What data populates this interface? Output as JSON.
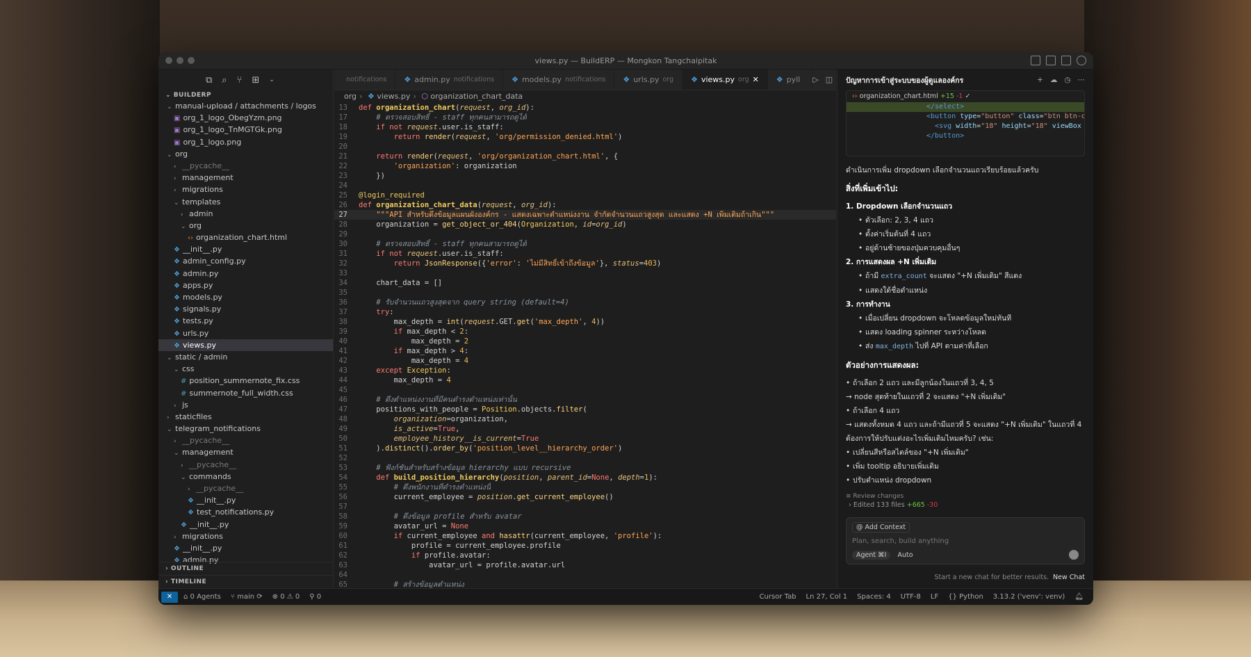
{
  "window": {
    "title": "views.py — BuildERP — Mongkon Tangchaipitak"
  },
  "explorer": {
    "section": "BUILDERP",
    "outline": "OUTLINE",
    "timeline": "TIMELINE",
    "items": [
      {
        "label": "manual-upload / attachments / logos",
        "indent": 0,
        "type": "folder-open"
      },
      {
        "label": "org_1_logo_ObegYzm.png",
        "indent": 1,
        "type": "img"
      },
      {
        "label": "org_1_logo_TnMGTGk.png",
        "indent": 1,
        "type": "img"
      },
      {
        "label": "org_1_logo.png",
        "indent": 1,
        "type": "img"
      },
      {
        "label": "org",
        "indent": 0,
        "type": "folder-open"
      },
      {
        "label": "__pycache__",
        "indent": 1,
        "type": "folder",
        "dim": true
      },
      {
        "label": "management",
        "indent": 1,
        "type": "folder"
      },
      {
        "label": "migrations",
        "indent": 1,
        "type": "folder"
      },
      {
        "label": "templates",
        "indent": 1,
        "type": "folder-open"
      },
      {
        "label": "admin",
        "indent": 2,
        "type": "folder"
      },
      {
        "label": "org",
        "indent": 2,
        "type": "folder-open"
      },
      {
        "label": "organization_chart.html",
        "indent": 3,
        "type": "html"
      },
      {
        "label": "__init__.py",
        "indent": 1,
        "type": "py"
      },
      {
        "label": "admin_config.py",
        "indent": 1,
        "type": "py"
      },
      {
        "label": "admin.py",
        "indent": 1,
        "type": "py"
      },
      {
        "label": "apps.py",
        "indent": 1,
        "type": "py"
      },
      {
        "label": "models.py",
        "indent": 1,
        "type": "py"
      },
      {
        "label": "signals.py",
        "indent": 1,
        "type": "py"
      },
      {
        "label": "tests.py",
        "indent": 1,
        "type": "py"
      },
      {
        "label": "urls.py",
        "indent": 1,
        "type": "py"
      },
      {
        "label": "views.py",
        "indent": 1,
        "type": "py",
        "selected": true
      },
      {
        "label": "static / admin",
        "indent": 0,
        "type": "folder-open"
      },
      {
        "label": "css",
        "indent": 1,
        "type": "folder-open"
      },
      {
        "label": "position_summernote_fix.css",
        "indent": 2,
        "type": "css"
      },
      {
        "label": "summernote_full_width.css",
        "indent": 2,
        "type": "css"
      },
      {
        "label": "js",
        "indent": 1,
        "type": "folder"
      },
      {
        "label": "staticfiles",
        "indent": 0,
        "type": "folder"
      },
      {
        "label": "telegram_notifications",
        "indent": 0,
        "type": "folder-open"
      },
      {
        "label": "__pycache__",
        "indent": 1,
        "type": "folder",
        "dim": true
      },
      {
        "label": "management",
        "indent": 1,
        "type": "folder-open"
      },
      {
        "label": "__pycache__",
        "indent": 2,
        "type": "folder",
        "dim": true
      },
      {
        "label": "commands",
        "indent": 2,
        "type": "folder-open"
      },
      {
        "label": "__pycache__",
        "indent": 3,
        "type": "folder",
        "dim": true
      },
      {
        "label": "__init__.py",
        "indent": 3,
        "type": "py"
      },
      {
        "label": "test_notifications.py",
        "indent": 3,
        "type": "py"
      },
      {
        "label": "__init__.py",
        "indent": 2,
        "type": "py"
      },
      {
        "label": "migrations",
        "indent": 1,
        "type": "folder"
      },
      {
        "label": "__init__.py",
        "indent": 1,
        "type": "py"
      },
      {
        "label": "admin.py",
        "indent": 1,
        "type": "py"
      }
    ]
  },
  "tabs": [
    {
      "label": "",
      "sub": "notifications",
      "active": false
    },
    {
      "label": "admin.py",
      "sub": "notifications",
      "active": false
    },
    {
      "label": "models.py",
      "sub": "notifications",
      "active": false
    },
    {
      "label": "urls.py",
      "sub": "org",
      "active": false
    },
    {
      "label": "views.py",
      "sub": "org",
      "active": true
    },
    {
      "label": "pyll",
      "sub": "",
      "active": false
    }
  ],
  "breadcrumb": {
    "a": "org",
    "b": "views.py",
    "c": "organization_chart_data"
  },
  "code": [
    {
      "n": 13,
      "h": "<span class='kw'>def</span> <span class='fn'>organization_chart</span>(<span class='pr'>request</span>, <span class='pr'>org_id</span>):"
    },
    {
      "n": 17,
      "h": "    <span class='cm'># ตรวจสอบสิทธิ์ - staff ทุกคนสามารถดูได้</span>"
    },
    {
      "n": 18,
      "h": "    <span class='kw'>if not</span> <span class='pr'>request</span>.user.is_staff:"
    },
    {
      "n": 19,
      "h": "        <span class='kw'>return</span> <span class='bi'>render</span>(<span class='pr'>request</span>, <span class='st'>'org/permission_denied.html'</span>)"
    },
    {
      "n": 20,
      "h": ""
    },
    {
      "n": 21,
      "h": "    <span class='kw'>return</span> <span class='bi'>render</span>(<span class='pr'>request</span>, <span class='st'>'org/organization_chart.html'</span>, {"
    },
    {
      "n": 22,
      "h": "        <span class='st'>'organization'</span>: organization"
    },
    {
      "n": 23,
      "h": "    })"
    },
    {
      "n": 24,
      "h": ""
    },
    {
      "n": 25,
      "h": "<span class='dec'>@login_required</span>"
    },
    {
      "n": 26,
      "h": "<span class='kw'>def</span> <span class='fn'>organization_chart_data</span>(<span class='pr'>request</span>, <span class='pr'>org_id</span>):"
    },
    {
      "n": 27,
      "h": "    <span class='ds'>\"\"\"API สำหรับดึงข้อมูลแผนผังองค์กร - แสดงเฉพาะตำแหน่งงาน จำกัดจำนวนแถวสูงสุด และแสดง +N เพิ่มเติมถ้าเกิน\"\"\"</span>",
      "cur": true
    },
    {
      "n": 28,
      "h": "    organization = <span class='bi'>get_object_or_404</span>(<span class='cl'>Organization</span>, <span class='pr'>id</span>=<span class='pr'>org_id</span>)"
    },
    {
      "n": 29,
      "h": ""
    },
    {
      "n": 30,
      "h": "    <span class='cm'># ตรวจสอบสิทธิ์ - staff ทุกคนสามารถดูได้</span>"
    },
    {
      "n": 31,
      "h": "    <span class='kw'>if not</span> <span class='pr'>request</span>.user.is_staff:"
    },
    {
      "n": 32,
      "h": "        <span class='kw'>return</span> <span class='bi'>JsonResponse</span>({<span class='st'>'error'</span>: <span class='st'>'ไม่มีสิทธิ์เข้าถึงข้อมูล'</span>}, <span class='pr'>status</span>=<span class='nm'>403</span>)"
    },
    {
      "n": 33,
      "h": ""
    },
    {
      "n": 34,
      "h": "    chart_data = []"
    },
    {
      "n": 35,
      "h": ""
    },
    {
      "n": 36,
      "h": "    <span class='cm'># รับจำนวนแถวสูงสุดจาก query string (default=4)</span>"
    },
    {
      "n": 37,
      "h": "    <span class='kw'>try</span>:"
    },
    {
      "n": 38,
      "h": "        max_depth = <span class='bi'>int</span>(<span class='pr'>request</span>.GET.<span class='bi'>get</span>(<span class='st'>'max_depth'</span>, <span class='nm'>4</span>))"
    },
    {
      "n": 39,
      "h": "        <span class='kw'>if</span> max_depth &lt; <span class='nm'>2</span>:"
    },
    {
      "n": 40,
      "h": "            max_depth = <span class='nm'>2</span>"
    },
    {
      "n": 41,
      "h": "        <span class='kw'>if</span> max_depth &gt; <span class='nm'>4</span>:"
    },
    {
      "n": 42,
      "h": "            max_depth = <span class='nm'>4</span>"
    },
    {
      "n": 43,
      "h": "    <span class='kw'>except</span> <span class='cl'>Exception</span>:"
    },
    {
      "n": 44,
      "h": "        max_depth = <span class='nm'>4</span>"
    },
    {
      "n": 45,
      "h": ""
    },
    {
      "n": 46,
      "h": "    <span class='cm'># ดึงตำแหน่งงานที่มีคนดำรงตำแหน่งเท่านั้น</span>"
    },
    {
      "n": 47,
      "h": "    positions_with_people = <span class='cl'>Position</span>.objects.<span class='bi'>filter</span>("
    },
    {
      "n": 48,
      "h": "        <span class='pr'>organization</span>=organization,"
    },
    {
      "n": 49,
      "h": "        <span class='pr'>is_active</span>=<span class='kw'>True</span>,"
    },
    {
      "n": 50,
      "h": "        <span class='pr'>employee_history__is_current</span>=<span class='kw'>True</span>"
    },
    {
      "n": 51,
      "h": "    ).<span class='bi'>distinct</span>().<span class='bi'>order_by</span>(<span class='st'>'position_level__hierarchy_order'</span>)"
    },
    {
      "n": 52,
      "h": ""
    },
    {
      "n": 53,
      "h": "    <span class='cm'># ฟังก์ชันสำหรับสร้างข้อมูล hierarchy แบบ recursive</span>"
    },
    {
      "n": 54,
      "h": "    <span class='kw'>def</span> <span class='fn'>build_position_hierarchy</span>(<span class='pr'>position</span>, <span class='pr'>parent_id</span>=<span class='kw'>None</span>, <span class='pr'>depth</span>=<span class='nm'>1</span>):"
    },
    {
      "n": 55,
      "h": "        <span class='cm'># ดึงพนักงานที่ดำรงตำแหน่งนี้</span>"
    },
    {
      "n": 56,
      "h": "        current_employee = <span class='pr'>position</span>.<span class='bi'>get_current_employee</span>()"
    },
    {
      "n": 57,
      "h": ""
    },
    {
      "n": 58,
      "h": "        <span class='cm'># ดึงข้อมูล profile สำหรับ avatar</span>"
    },
    {
      "n": 59,
      "h": "        avatar_url = <span class='kw'>None</span>"
    },
    {
      "n": 60,
      "h": "        <span class='kw'>if</span> current_employee <span class='kw'>and</span> <span class='bi'>hasattr</span>(current_employee, <span class='st'>'profile'</span>):"
    },
    {
      "n": 61,
      "h": "            profile = current_employee.profile"
    },
    {
      "n": 62,
      "h": "            <span class='kw'>if</span> profile.avatar:"
    },
    {
      "n": 63,
      "h": "                avatar_url = profile.avatar.url"
    },
    {
      "n": 64,
      "h": ""
    },
    {
      "n": 65,
      "h": "        <span class='cm'># สร้างข้อมูลตำแหน่ง</span>"
    }
  ],
  "chat": {
    "title": "ปัญหาการเข้าสู่ระบบของผู้ดูแลองค์กร",
    "diff_file": "organization_chart.html",
    "diff_add": "+15",
    "diff_del": "-1",
    "diff_lines": [
      {
        "h": "<span class='tg'>&lt;/select&gt;</span>",
        "hl": true
      },
      {
        "h": "<span class='tg'>&lt;button</span> <span class='at'>type</span>=<span class='av'>\"button\"</span> <span class='at'>class</span>=<span class='av'>\"btn btn-ou</span>",
        "hl": false
      },
      {
        "h": "  <span class='tg'>&lt;svg</span> <span class='at'>width</span>=<span class='av'>\"18\"</span> <span class='at'>height</span>=<span class='av'>\"18\"</span> <span class='at'>viewBox</span>",
        "hl": false
      },
      {
        "h": "<span class='tg'>&lt;/button&gt;</span>",
        "hl": false
      }
    ],
    "intro": "ดำเนินการเพิ่ม dropdown เลือกจำนวนแถวเรียบร้อยแล้วครับ",
    "added_heading": "สิ่งที่เพิ่มเข้าไป:",
    "s1": "1. Dropdown เลือกจำนวนแถว",
    "s1a": "ตัวเลือก: 2, 3, 4 แถว",
    "s1b": "ตั้งค่าเริ่มต้นที่ 4 แถว",
    "s1c": "อยู่ด้านซ้ายของปุ่มควบคุมอื่นๆ",
    "s2": "2. การแสดงผล +N เพิ่มเติม",
    "s2a_pre": "ถ้ามี",
    "s2a_code": "extra_count",
    "s2a_post": "จะแสดง \"+N เพิ่มเติม\" สีแดง",
    "s2b": "แสดงใต้ชื่อตำแหน่ง",
    "s3": "3. การทำงาน",
    "s3a": "เมื่อเปลี่ยน dropdown จะโหลดข้อมูลใหม่ทันที",
    "s3b": "แสดง loading spinner ระหว่างโหลด",
    "s3c_pre": "ส่ง",
    "s3c_code": "max_depth",
    "s3c_post": "ไปที่ API ตามค่าที่เลือก",
    "ex_heading": "ตัวอย่างการแสดงผล:",
    "e1": "ถ้าเลือก 2 แถว และมีลูกน้องในแถวที่ 3, 4, 5",
    "e2": "→ node สุดท้ายในแถวที่ 2 จะแสดง \"+N เพิ่มเติม\"",
    "e3": "ถ้าเลือก 4 แถว",
    "e4": "→ แสดงทั้งหมด 4 แถว และถ้ามีแถวที่ 5 จะแสดง \"+N เพิ่มเติม\" ในแถวที่ 4",
    "q": "ต้องการให้ปรับแต่งอะไรเพิ่มเติมไหมครับ? เช่น:",
    "o1": "เปลี่ยนสีหรือสไตล์ของ \"+N เพิ่มเติม\"",
    "o2": "เพิ่ม tooltip อธิบายเพิ่มเติม",
    "o3": "ปรับตำแหน่ง dropdown",
    "review": "Review changes",
    "edited": "Edited 133 files",
    "edited_add": "+665",
    "edited_del": "-30",
    "add_context": "Add Context",
    "placeholder": "Plan, search, build anything",
    "agent": "Agent ⌘I",
    "auto": "Auto",
    "newchat_hint": "Start a new chat for better results.",
    "newchat_btn": "New Chat"
  },
  "status": {
    "agents": "0 Agents",
    "branch": "main",
    "problems": "⊗ 0 ⚠ 0",
    "ports": "⚲ 0",
    "cursor_tab": "Cursor Tab",
    "position": "Ln 27, Col 1",
    "spaces": "Spaces: 4",
    "encoding": "UTF-8",
    "eol": "LF",
    "lang": "Python",
    "interpreter": "3.13.2 ('venv': venv)"
  }
}
